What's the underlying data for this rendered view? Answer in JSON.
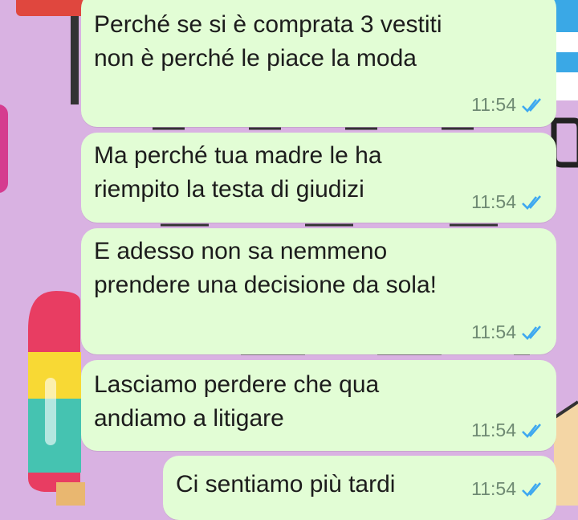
{
  "chat": {
    "messages": [
      {
        "text": "Perché se si è comprata 3 vestiti\nnon è perché le piace la moda",
        "time": "11:54",
        "status": "read"
      },
      {
        "text": "Ma perché tua madre le ha\nriempito la testa di giudizi",
        "time": "11:54",
        "status": "read"
      },
      {
        "text": "E adesso non sa nemmeno\nprendere una decisione da sola!",
        "time": "11:54",
        "status": "read"
      },
      {
        "text": "Lasciamo perdere che qua\nandiamo a litigare",
        "time": "11:54",
        "status": "read"
      },
      {
        "text": "Ci sentiamo più tardi",
        "time": "11:54",
        "status": "read"
      }
    ]
  },
  "colors": {
    "bubble_outgoing": "#e2fdd5",
    "wallpaper_background": "#d9b2e2",
    "read_tick": "#3ea8f0",
    "time_text": "#6f8a73"
  },
  "icons": {
    "read_receipt": "double-check-icon"
  }
}
